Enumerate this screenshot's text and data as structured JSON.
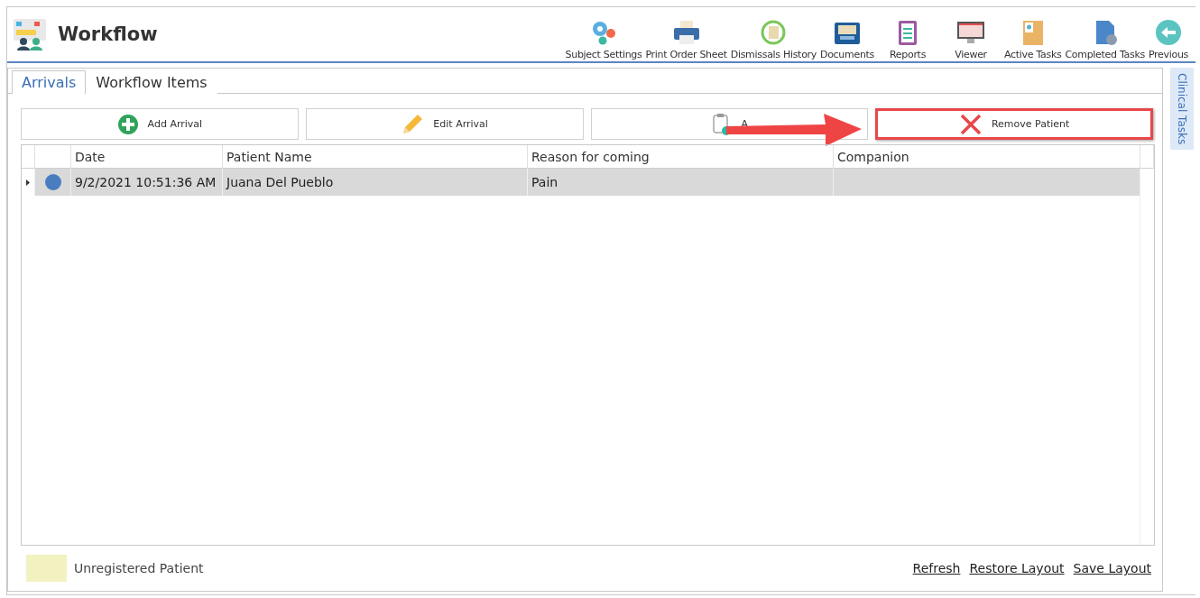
{
  "window": {
    "title": "Workflow"
  },
  "toolbar": [
    {
      "label": "Subject Settings"
    },
    {
      "label": "Print Order Sheet"
    },
    {
      "label": "Dismissals History"
    },
    {
      "label": "Documents"
    },
    {
      "label": "Reports"
    },
    {
      "label": "Viewer"
    },
    {
      "label": "Active Tasks"
    },
    {
      "label": "Completed Tasks"
    },
    {
      "label": "Previous"
    }
  ],
  "tabs": [
    {
      "label": "Arrivals",
      "selected": true
    },
    {
      "label": "Workflow Items",
      "selected": false
    }
  ],
  "actions": [
    {
      "label": "Add Arrival",
      "highlighted": false
    },
    {
      "label": "Edit Arrival",
      "highlighted": false
    },
    {
      "label": "A",
      "highlighted": false
    },
    {
      "label": "Remove Patient",
      "highlighted": true
    }
  ],
  "table": {
    "columns": [
      "Date",
      "Patient Name",
      "Reason for coming",
      "Companion"
    ],
    "rows": [
      {
        "selected": true,
        "color": "#4a7cc0",
        "cells": [
          "9/2/2021 10:51:36 AM",
          "Juana Del Pueblo",
          "Pain",
          ""
        ]
      }
    ]
  },
  "legend": {
    "label": "Unregistered Patient",
    "color": "#f2f2c0"
  },
  "links": [
    "Refresh",
    "Restore Layout",
    "Save Layout"
  ],
  "side_panel": {
    "label": "Clinical Tasks"
  }
}
